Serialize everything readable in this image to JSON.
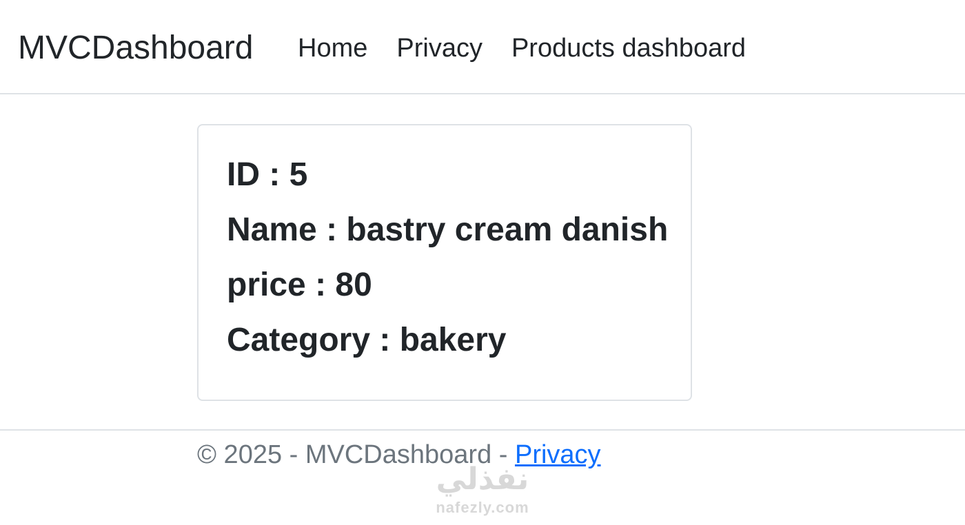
{
  "header": {
    "brand": "MVCDashboard",
    "nav": [
      {
        "label": "Home"
      },
      {
        "label": "Privacy"
      },
      {
        "label": "Products dashboard"
      }
    ]
  },
  "product": {
    "id_line": "ID : 5",
    "name_line": "Name : bastry cream danish",
    "price_line": "price : 80",
    "category_line": "Category : bakery"
  },
  "footer": {
    "copyright": "© 2025 - MVCDashboard - ",
    "privacy_link": "Privacy"
  },
  "watermark": {
    "logo": "نفذلي",
    "url": "nafezly.com"
  }
}
